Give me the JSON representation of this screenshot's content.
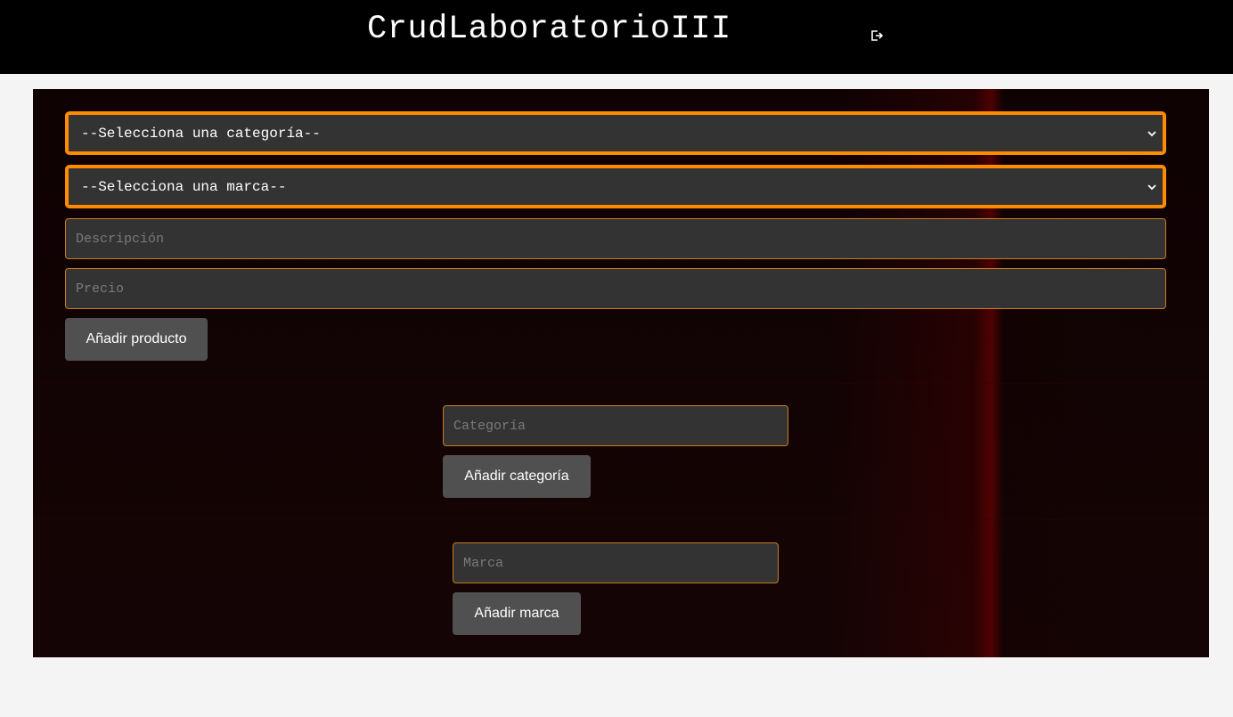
{
  "header": {
    "title": "CrudLaboratorioIII",
    "logout_icon": "logout-icon"
  },
  "product_form": {
    "category_select": {
      "selected": "--Selecciona una categoría--"
    },
    "brand_select": {
      "selected": "--Selecciona una marca--"
    },
    "description_input": {
      "placeholder": "Descripción",
      "value": ""
    },
    "price_input": {
      "placeholder": "Precio",
      "value": ""
    },
    "submit_label": "Añadir producto"
  },
  "category_form": {
    "input": {
      "placeholder": "Categoría",
      "value": ""
    },
    "submit_label": "Añadir categoría"
  },
  "brand_form": {
    "input": {
      "placeholder": "Marca",
      "value": ""
    },
    "submit_label": "Añadir marca"
  },
  "colors": {
    "accent": "#ff8c00",
    "header_bg": "#000000",
    "field_bg": "#333333",
    "button_bg": "#505050",
    "page_bg": "#f4f4f4"
  }
}
